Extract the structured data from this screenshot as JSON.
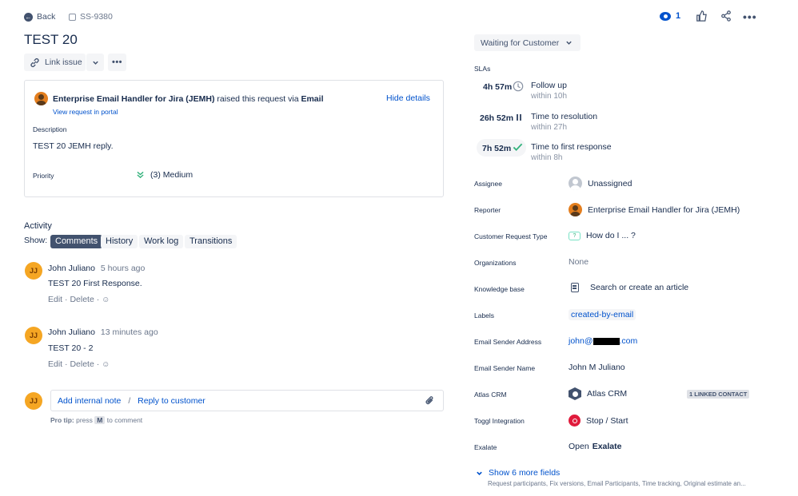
{
  "header": {
    "back_label": "Back",
    "issue_key": "SS-9380",
    "title": "TEST 20",
    "watch_count": "1"
  },
  "toolbar": {
    "link_issue_label": "Link issue"
  },
  "request_box": {
    "reporter": "Enterprise Email Handler for Jira (JEMH)",
    "raised_text": "raised this request via",
    "channel": "Email",
    "view_portal": "View request in portal",
    "hide_details": "Hide details",
    "description_label": "Description",
    "description": "TEST 20 JEMH reply.",
    "priority_label": "Priority",
    "priority_value": "(3) Medium"
  },
  "activity": {
    "title": "Activity",
    "show_label": "Show:",
    "tabs": [
      "Comments",
      "History",
      "Work log",
      "Transitions"
    ],
    "comments": [
      {
        "initials": "JJ",
        "author": "John Juliano",
        "time": "5 hours ago",
        "body": "TEST 20 First Response.",
        "edit": "Edit",
        "delete": "Delete"
      },
      {
        "initials": "JJ",
        "author": "John Juliano",
        "time": "13 minutes ago",
        "body": "TEST 20 - 2",
        "edit": "Edit",
        "delete": "Delete"
      }
    ],
    "composer": {
      "initials": "JJ",
      "internal_note": "Add internal note",
      "separator": "/",
      "reply": "Reply to customer",
      "protip_bold": "Pro tip:",
      "protip_press": "press",
      "protip_key": "M",
      "protip_rest": "to comment"
    }
  },
  "status": {
    "label": "Waiting for Customer"
  },
  "slas": {
    "title": "SLAs",
    "items": [
      {
        "time": "4h 57m",
        "name": "Follow up",
        "goal": "within 10h",
        "state": "clock"
      },
      {
        "time": "26h 52m",
        "name": "Time to resolution",
        "goal": "within 27h",
        "state": "paused"
      },
      {
        "time": "7h 52m",
        "name": "Time to first response",
        "goal": "within 8h",
        "state": "met"
      }
    ]
  },
  "fields": {
    "assignee": {
      "label": "Assignee",
      "value": "Unassigned"
    },
    "reporter": {
      "label": "Reporter",
      "value": "Enterprise Email Handler for Jira (JEMH)"
    },
    "request_type": {
      "label": "Customer Request Type",
      "value": "How do I ... ?"
    },
    "organizations": {
      "label": "Organizations",
      "value": "None"
    },
    "knowledge_base": {
      "label": "Knowledge base",
      "value": "Search or create an article"
    },
    "labels": {
      "label": "Labels",
      "value": "created-by-email"
    },
    "sender_address": {
      "label": "Email Sender Address",
      "value_start": "john@",
      "value_end": ".com"
    },
    "sender_name": {
      "label": "Email Sender Name",
      "value": "John M Juliano"
    },
    "atlas_crm": {
      "label": "Atlas CRM",
      "value": "Atlas CRM",
      "badge": "1 LINKED CONTACT"
    },
    "toggl": {
      "label": "Toggl Integration",
      "value": "Stop / Start"
    },
    "exalate": {
      "label": "Exalate",
      "value_prefix": "Open",
      "value_bold": "Exalate"
    }
  },
  "more_fields": {
    "label": "Show 6 more fields",
    "sub": "Request participants, Fix versions, Email Participants, Time tracking, Original estimate an..."
  },
  "colors": {
    "link": "#0052cc",
    "tab_active": "#42526e",
    "avatar_orange": "#f5a623",
    "green": "#36b37e",
    "badge_bg": "#dfe1e6"
  }
}
